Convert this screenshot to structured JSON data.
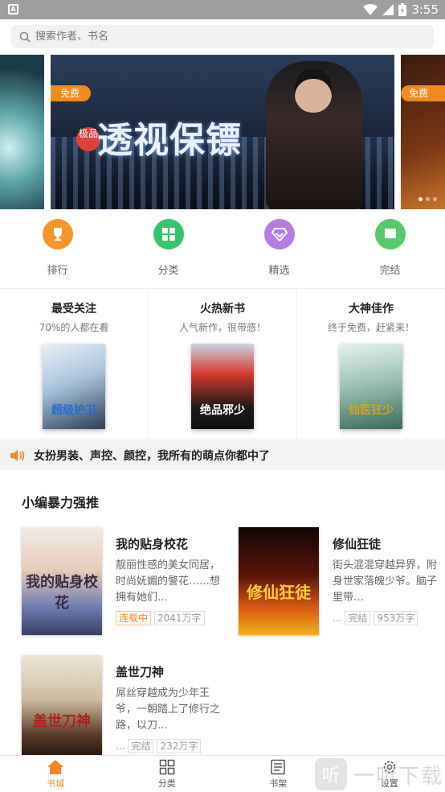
{
  "status_bar": {
    "time": "3:55",
    "app_icon": "A",
    "icons": [
      "wifi-icon",
      "signal-icon",
      "battery-icon"
    ]
  },
  "search": {
    "placeholder": "搜索作者、书名"
  },
  "banner": {
    "slides": [
      {
        "badge": "",
        "title": ""
      },
      {
        "badge": "免费",
        "tag": "极品",
        "title": "透视保镖"
      },
      {
        "badge": "免费",
        "title": ""
      }
    ],
    "active_index": 1,
    "dot_count": 3
  },
  "categories": [
    {
      "label": "排行",
      "icon": "trophy-icon",
      "color": "#f4972b"
    },
    {
      "label": "分类",
      "icon": "grid-icon",
      "color": "#35c46b"
    },
    {
      "label": "精选",
      "icon": "diamond-icon",
      "color": "#b57ce0"
    },
    {
      "label": "完结",
      "icon": "book-icon",
      "color": "#58c86a"
    }
  ],
  "features": [
    {
      "title": "最受关注",
      "subtitle": "70%的人都在看",
      "cover_text": "超级护卫"
    },
    {
      "title": "火热新书",
      "subtitle": "人气新作，很带感！",
      "cover_text": "绝品邪少"
    },
    {
      "title": "大神佳作",
      "subtitle": "终于免费，赶紧来！",
      "cover_text": "仙医狂少"
    }
  ],
  "notice": {
    "text": "女扮男装、声控、颜控，我所有的萌点你都中了"
  },
  "recommend": {
    "title": "小编暴力强推",
    "books": [
      {
        "title": "我的贴身校花",
        "desc": "靓丽性感的美女同居，时尚妩媚的警花……想拥有她们…",
        "status": "连载中",
        "words": "2041万字",
        "cover_text": "我的贴身校花"
      },
      {
        "title": "修仙狂徒",
        "desc": "街头混混穿越异界，附身世家落魄少爷。脑子里带…",
        "status": "完结",
        "words": "953万字",
        "cover_text": "修仙狂徒"
      },
      {
        "title": "盖世刀神",
        "desc": "屌丝穿越成为少年王爷，一朝踏上了修行之路，以刀…",
        "status": "完结",
        "words": "232万字",
        "cover_text": "盖世刀神"
      }
    ]
  },
  "bottom_nav": [
    {
      "label": "书城",
      "icon": "home-icon",
      "active": true
    },
    {
      "label": "分类",
      "icon": "grid-icon",
      "active": false
    },
    {
      "label": "书架",
      "icon": "bookshelf-icon",
      "active": false
    },
    {
      "label": "设置",
      "icon": "gear-icon",
      "active": false
    }
  ],
  "watermark": {
    "text": "一听下载",
    "glyph": "听"
  },
  "colors": {
    "accent": "#f08a1e"
  }
}
